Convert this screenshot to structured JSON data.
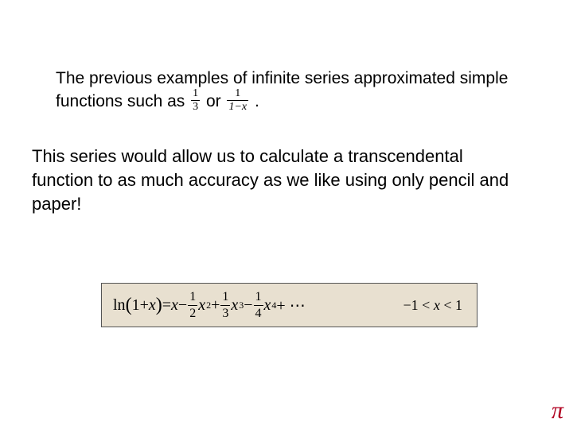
{
  "paragraph1": {
    "part1": "The previous examples of infinite series approximated simple functions such as ",
    "frac1_num": "1",
    "frac1_den": "3",
    "or": " or ",
    "frac2_num": "1",
    "frac2_den": "1−x",
    "period": "."
  },
  "paragraph2": "This series would allow us to calculate a transcendental function to as much accuracy as we like using only pencil and paper!",
  "formula": {
    "lhs_prefix": "ln",
    "lhs_paren_open": "(",
    "lhs_inner": "1+",
    "lhs_var": "x",
    "lhs_paren_close": ")",
    "eq": " = ",
    "var": "x",
    "minus": " − ",
    "plus": " + ",
    "t2_num": "1",
    "t2_den": "2",
    "t2_exp": "2",
    "t3_num": "1",
    "t3_den": "3",
    "t3_exp": "3",
    "t4_num": "1",
    "t4_den": "4",
    "t4_exp": "4",
    "dots": " + ⋯",
    "domain": "−1 < x < 1"
  },
  "pi": "π"
}
